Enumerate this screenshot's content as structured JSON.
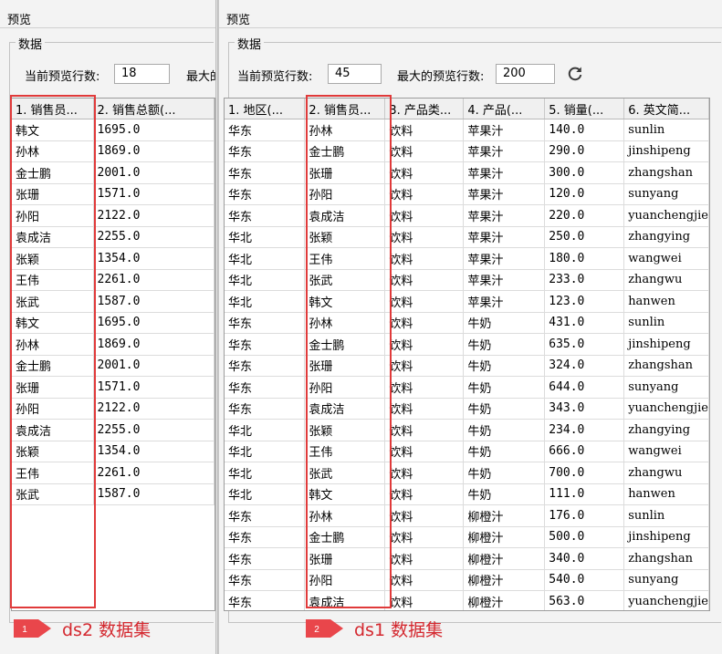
{
  "left": {
    "title": "预览",
    "group_label": "数据",
    "current_rows_label": "当前预览行数:",
    "current_rows_value": "18",
    "max_rows_label": "最大的",
    "columns": [
      "1. 销售员...",
      "2. 销售总额(..."
    ],
    "rows": [
      [
        "韩文",
        "1695.0"
      ],
      [
        "孙林",
        "1869.0"
      ],
      [
        "金士鹏",
        "2001.0"
      ],
      [
        "张珊",
        "1571.0"
      ],
      [
        "孙阳",
        "2122.0"
      ],
      [
        "袁成洁",
        "2255.0"
      ],
      [
        "张颖",
        "1354.0"
      ],
      [
        "王伟",
        "2261.0"
      ],
      [
        "张武",
        "1587.0"
      ],
      [
        "韩文",
        "1695.0"
      ],
      [
        "孙林",
        "1869.0"
      ],
      [
        "金士鹏",
        "2001.0"
      ],
      [
        "张珊",
        "1571.0"
      ],
      [
        "孙阳",
        "2122.0"
      ],
      [
        "袁成洁",
        "2255.0"
      ],
      [
        "张颖",
        "1354.0"
      ],
      [
        "王伟",
        "2261.0"
      ],
      [
        "张武",
        "1587.0"
      ]
    ]
  },
  "right": {
    "title": "预览",
    "group_label": "数据",
    "current_rows_label": "当前预览行数:",
    "current_rows_value": "45",
    "max_rows_label": "最大的预览行数:",
    "max_rows_value": "200",
    "columns": [
      "1. 地区(...",
      "2. 销售员...",
      "3. 产品类...",
      "4. 产品(...",
      "5. 销量(...",
      "6. 英文简..."
    ],
    "rows": [
      [
        "华东",
        "孙林",
        "饮料",
        "苹果汁",
        "140.0",
        "sunlin"
      ],
      [
        "华东",
        "金士鹏",
        "饮料",
        "苹果汁",
        "290.0",
        "jinshipeng"
      ],
      [
        "华东",
        "张珊",
        "饮料",
        "苹果汁",
        "300.0",
        "zhangshan"
      ],
      [
        "华东",
        "孙阳",
        "饮料",
        "苹果汁",
        "120.0",
        "sunyang"
      ],
      [
        "华东",
        "袁成洁",
        "饮料",
        "苹果汁",
        "220.0",
        "yuanchengjie"
      ],
      [
        "华北",
        "张颖",
        "饮料",
        "苹果汁",
        "250.0",
        "zhangying"
      ],
      [
        "华北",
        "王伟",
        "饮料",
        "苹果汁",
        "180.0",
        "wangwei"
      ],
      [
        "华北",
        "张武",
        "饮料",
        "苹果汁",
        "233.0",
        "zhangwu"
      ],
      [
        "华北",
        "韩文",
        "饮料",
        "苹果汁",
        "123.0",
        "hanwen"
      ],
      [
        "华东",
        "孙林",
        "饮料",
        "牛奶",
        "431.0",
        "sunlin"
      ],
      [
        "华东",
        "金士鹏",
        "饮料",
        "牛奶",
        "635.0",
        "jinshipeng"
      ],
      [
        "华东",
        "张珊",
        "饮料",
        "牛奶",
        "324.0",
        "zhangshan"
      ],
      [
        "华东",
        "孙阳",
        "饮料",
        "牛奶",
        "644.0",
        "sunyang"
      ],
      [
        "华东",
        "袁成洁",
        "饮料",
        "牛奶",
        "343.0",
        "yuanchengjie"
      ],
      [
        "华北",
        "张颖",
        "饮料",
        "牛奶",
        "234.0",
        "zhangying"
      ],
      [
        "华北",
        "王伟",
        "饮料",
        "牛奶",
        "666.0",
        "wangwei"
      ],
      [
        "华北",
        "张武",
        "饮料",
        "牛奶",
        "700.0",
        "zhangwu"
      ],
      [
        "华北",
        "韩文",
        "饮料",
        "牛奶",
        "111.0",
        "hanwen"
      ],
      [
        "华东",
        "孙林",
        "饮料",
        "柳橙汁",
        "176.0",
        "sunlin"
      ],
      [
        "华东",
        "金士鹏",
        "饮料",
        "柳橙汁",
        "500.0",
        "jinshipeng"
      ],
      [
        "华东",
        "张珊",
        "饮料",
        "柳橙汁",
        "340.0",
        "zhangshan"
      ],
      [
        "华东",
        "孙阳",
        "饮料",
        "柳橙汁",
        "540.0",
        "sunyang"
      ],
      [
        "华东",
        "袁成洁",
        "饮料",
        "柳橙汁",
        "563.0",
        "yuanchengjie"
      ]
    ]
  },
  "callouts": [
    {
      "number": "1",
      "text": "ds2 数据集"
    },
    {
      "number": "2",
      "text": "ds1 数据集"
    }
  ],
  "colors": {
    "highlight": "#e03a3a",
    "callout_text": "#d4282f",
    "callout_badge": "#e9464b"
  }
}
